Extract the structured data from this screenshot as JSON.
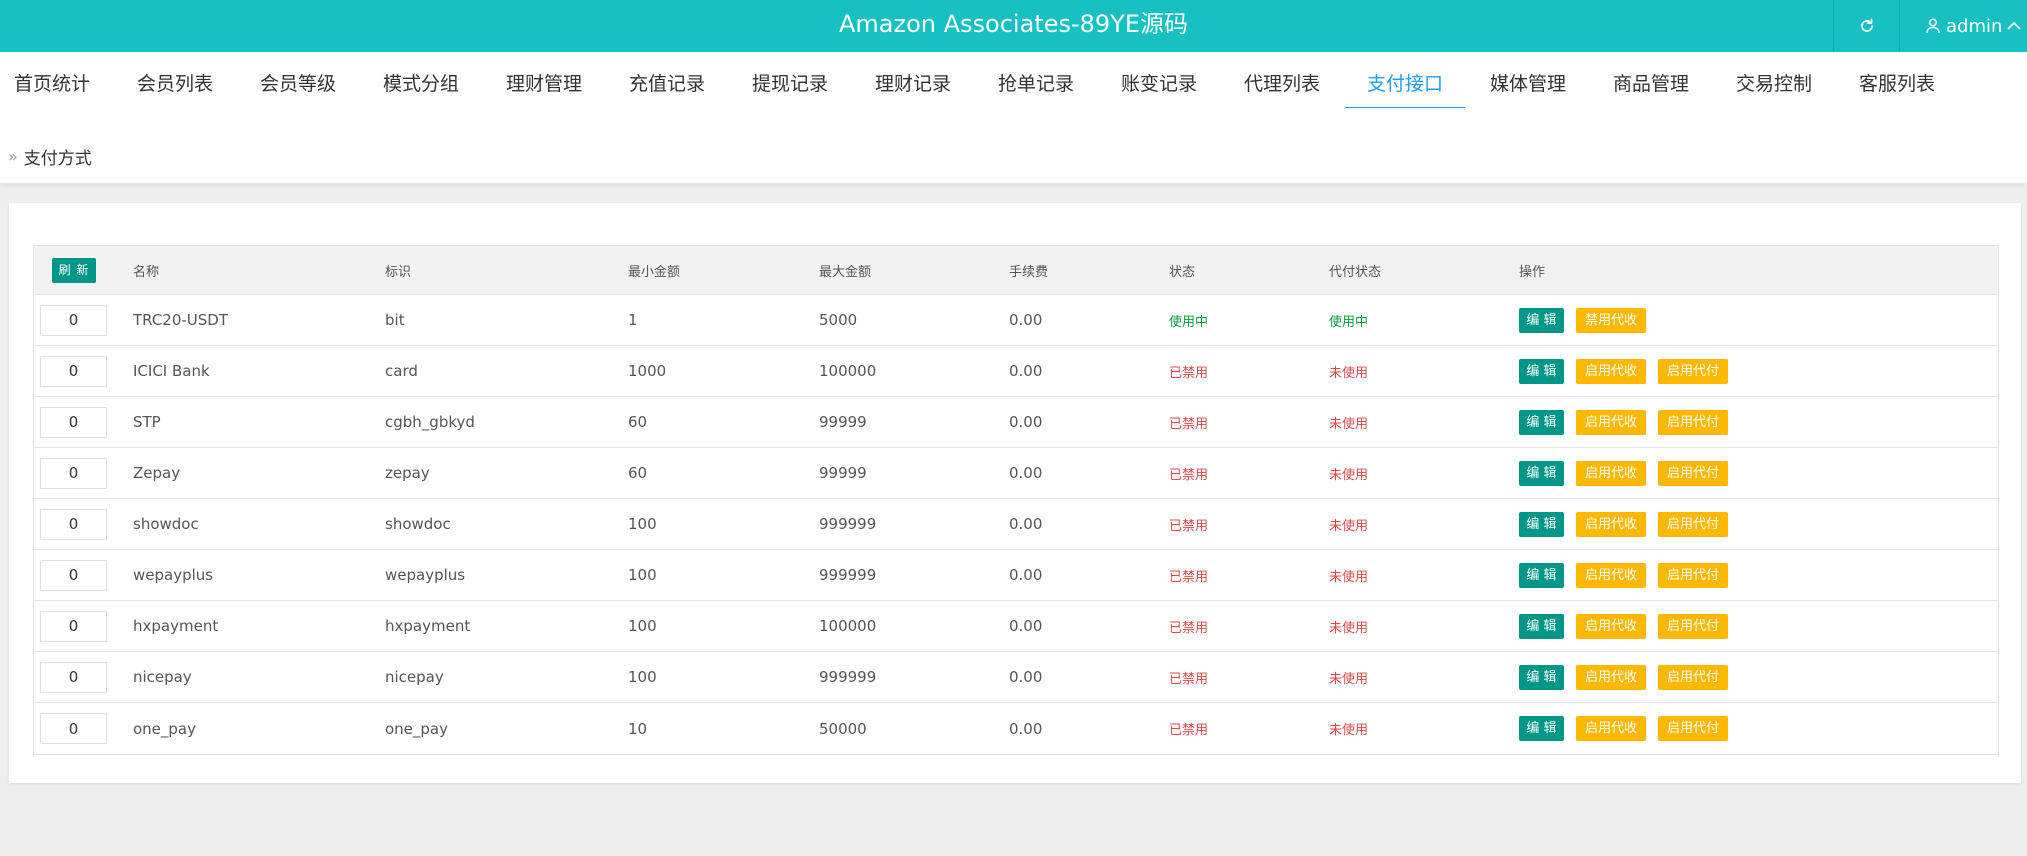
{
  "header": {
    "title": "Amazon Associates-89YE源码",
    "user": "admin",
    "colors": {
      "topbar": "#17c1c3",
      "active_nav": "#1e9fff",
      "primary": "#009688",
      "warning": "#ffb800",
      "on": "#009f3c",
      "off": "#e44747"
    }
  },
  "nav": {
    "items": [
      "首页统计",
      "会员列表",
      "会员等级",
      "模式分组",
      "理财管理",
      "充值记录",
      "提现记录",
      "理财记录",
      "抢单记录",
      "账变记录",
      "代理列表",
      "支付接口",
      "媒体管理",
      "商品管理",
      "交易控制",
      "客服列表"
    ],
    "active": "支付接口"
  },
  "breadcrumb": {
    "current": "支付方式"
  },
  "table": {
    "refresh_label": "刷 新",
    "headers": [
      "名称",
      "标识",
      "最小金额",
      "最大金额",
      "手续费",
      "状态",
      "代付状态",
      "操作"
    ],
    "rows": [
      {
        "sort": "0",
        "name": "TRC20-USDT",
        "code": "bit",
        "min": "1",
        "max": "5000",
        "fee": "0.00",
        "status": "使用中",
        "payout": "使用中",
        "actions": [
          "编 辑",
          "禁用代收"
        ]
      },
      {
        "sort": "0",
        "name": "ICICI Bank",
        "code": "card",
        "min": "1000",
        "max": "100000",
        "fee": "0.00",
        "status": "已禁用",
        "payout": "未使用",
        "actions": [
          "编 辑",
          "启用代收",
          "启用代付"
        ]
      },
      {
        "sort": "0",
        "name": "STP",
        "code": "cgbh_gbkyd",
        "min": "60",
        "max": "99999",
        "fee": "0.00",
        "status": "已禁用",
        "payout": "未使用",
        "actions": [
          "编 辑",
          "启用代收",
          "启用代付"
        ]
      },
      {
        "sort": "0",
        "name": "Zepay",
        "code": "zepay",
        "min": "60",
        "max": "99999",
        "fee": "0.00",
        "status": "已禁用",
        "payout": "未使用",
        "actions": [
          "编 辑",
          "启用代收",
          "启用代付"
        ]
      },
      {
        "sort": "0",
        "name": "showdoc",
        "code": "showdoc",
        "min": "100",
        "max": "999999",
        "fee": "0.00",
        "status": "已禁用",
        "payout": "未使用",
        "actions": [
          "编 辑",
          "启用代收",
          "启用代付"
        ]
      },
      {
        "sort": "0",
        "name": "wepayplus",
        "code": "wepayplus",
        "min": "100",
        "max": "999999",
        "fee": "0.00",
        "status": "已禁用",
        "payout": "未使用",
        "actions": [
          "编 辑",
          "启用代收",
          "启用代付"
        ]
      },
      {
        "sort": "0",
        "name": "hxpayment",
        "code": "hxpayment",
        "min": "100",
        "max": "100000",
        "fee": "0.00",
        "status": "已禁用",
        "payout": "未使用",
        "actions": [
          "编 辑",
          "启用代收",
          "启用代付"
        ]
      },
      {
        "sort": "0",
        "name": "nicepay",
        "code": "nicepay",
        "min": "100",
        "max": "999999",
        "fee": "0.00",
        "status": "已禁用",
        "payout": "未使用",
        "actions": [
          "编 辑",
          "启用代收",
          "启用代付"
        ]
      },
      {
        "sort": "0",
        "name": "one_pay",
        "code": "one_pay",
        "min": "10",
        "max": "50000",
        "fee": "0.00",
        "status": "已禁用",
        "payout": "未使用",
        "actions": [
          "编 辑",
          "启用代收",
          "启用代付"
        ]
      }
    ]
  }
}
